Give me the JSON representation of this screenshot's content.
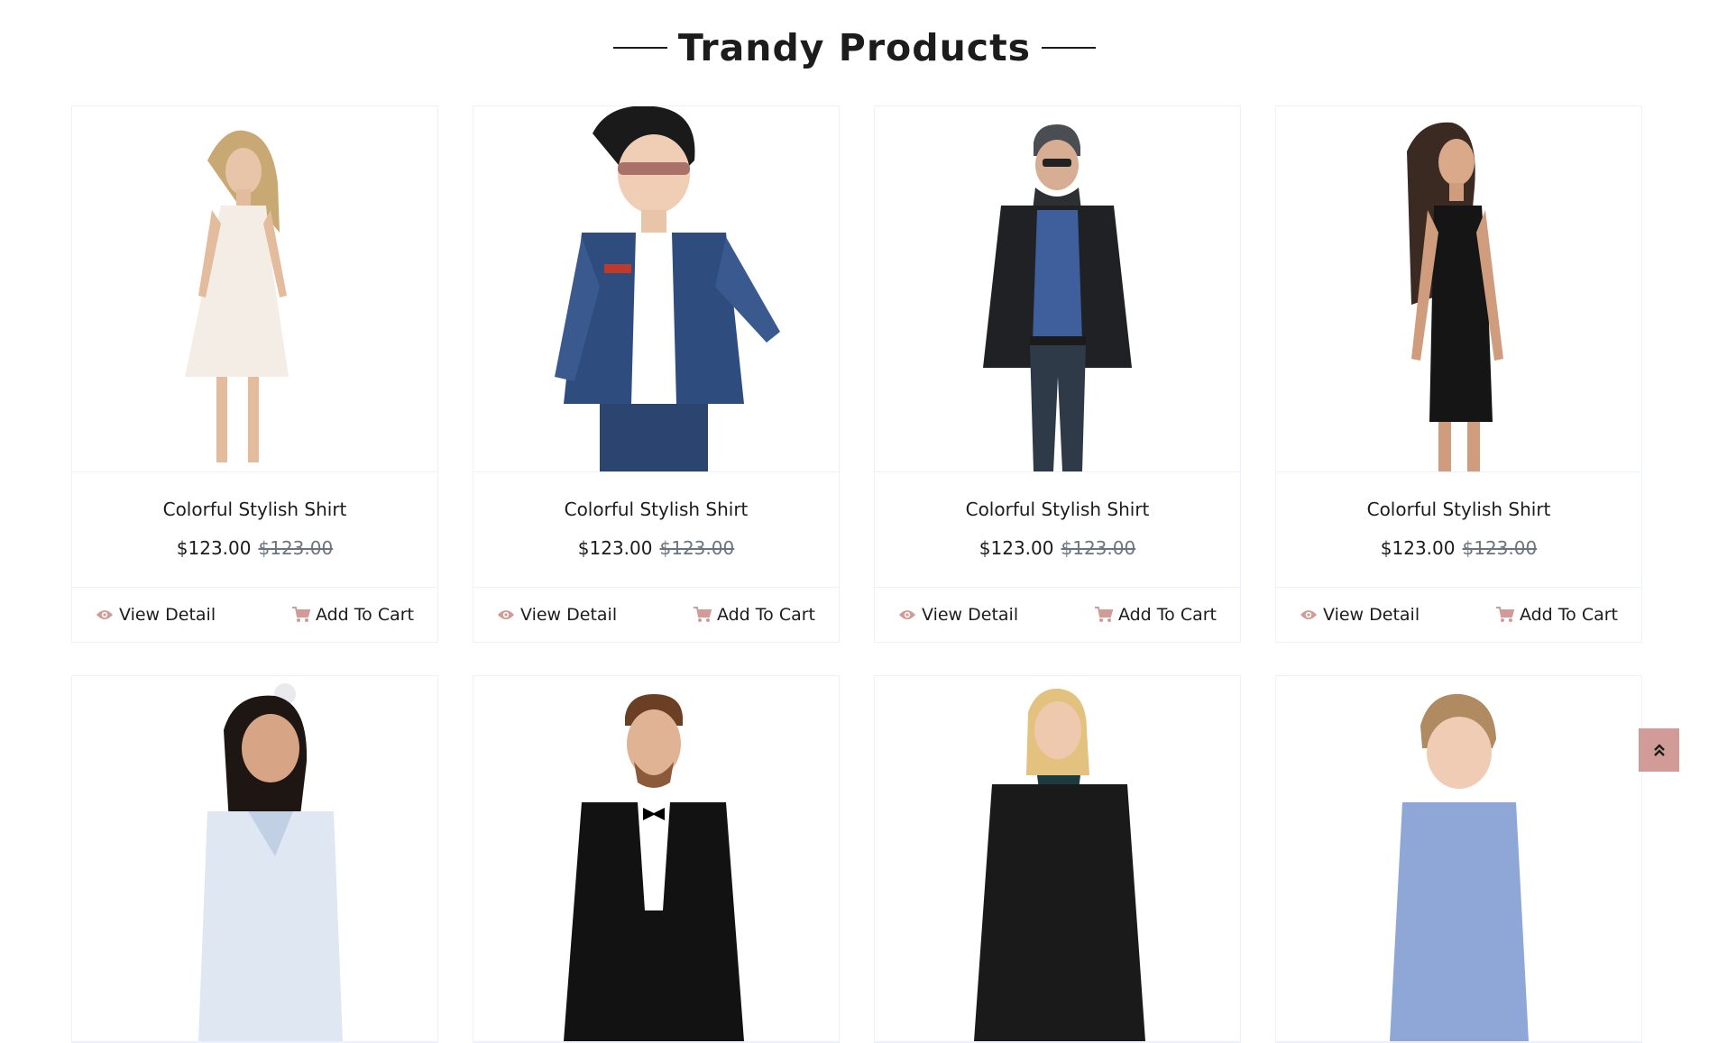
{
  "section": {
    "title": "Trandy Products"
  },
  "colors": {
    "accent": "#d19c97",
    "text": "#1c1c1c",
    "muted": "#6c757d",
    "border": "#edf1ff"
  },
  "products": [
    {
      "name": "Colorful Stylish Shirt",
      "price": "$123.00",
      "old_price": "$123.00",
      "image": "woman-white-dress"
    },
    {
      "name": "Colorful Stylish Shirt",
      "price": "$123.00",
      "old_price": "$123.00",
      "image": "boy-denim-jacket"
    },
    {
      "name": "Colorful Stylish Shirt",
      "price": "$123.00",
      "old_price": "$123.00",
      "image": "man-leather-jacket"
    },
    {
      "name": "Colorful Stylish Shirt",
      "price": "$123.00",
      "old_price": "$123.00",
      "image": "woman-black-dress"
    },
    {
      "image": "girl-white-top"
    },
    {
      "image": "man-tuxedo"
    },
    {
      "image": "woman-black-coat"
    },
    {
      "image": "boy-blue-shirt"
    }
  ],
  "actions": {
    "view_detail": "View Detail",
    "add_to_cart": "Add To Cart"
  },
  "icons": {
    "view": "eye-icon",
    "cart": "shopping-cart-icon",
    "back_to_top": "double-chevron-up-icon"
  }
}
